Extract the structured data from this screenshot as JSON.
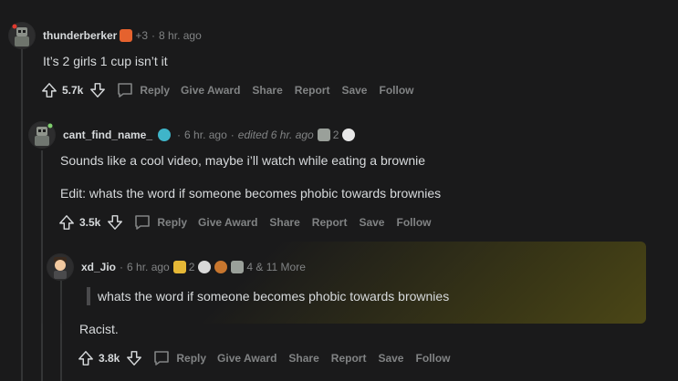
{
  "comments": [
    {
      "username": "thunderberker",
      "karma_badge": "+3",
      "time": "8 hr. ago",
      "body": [
        "It’s 2 girls 1 cup isn’t it"
      ],
      "votes": "5.7k",
      "actions": {
        "reply": "Reply",
        "give_award": "Give Award",
        "share": "Share",
        "report": "Report",
        "save": "Save",
        "follow": "Follow"
      }
    },
    {
      "username": "cant_find_name_",
      "time": "6 hr. ago",
      "edited": "edited 6 hr. ago",
      "award_count": "2",
      "body": [
        "Sounds like a cool video, maybe i’ll watch while eating a brownie",
        "Edit: whats the word if someone becomes phobic towards brownies"
      ],
      "votes": "3.5k",
      "actions": {
        "reply": "Reply",
        "give_award": "Give Award",
        "share": "Share",
        "report": "Report",
        "save": "Save",
        "follow": "Follow"
      }
    },
    {
      "username": "xd_Jio",
      "time": "6 hr. ago",
      "award_count": "2",
      "more_awards": "4 & 11 More",
      "quote": "whats the word if someone becomes phobic towards brownies",
      "body": [
        "Racist."
      ],
      "votes": "3.8k",
      "actions": {
        "reply": "Reply",
        "give_award": "Give Award",
        "share": "Share",
        "report": "Report",
        "save": "Save",
        "follow": "Follow"
      }
    }
  ],
  "colors": {
    "background": "#1a1a1b",
    "text": "#d7dadc",
    "muted": "#818384",
    "highlight": "#4f4b16"
  }
}
